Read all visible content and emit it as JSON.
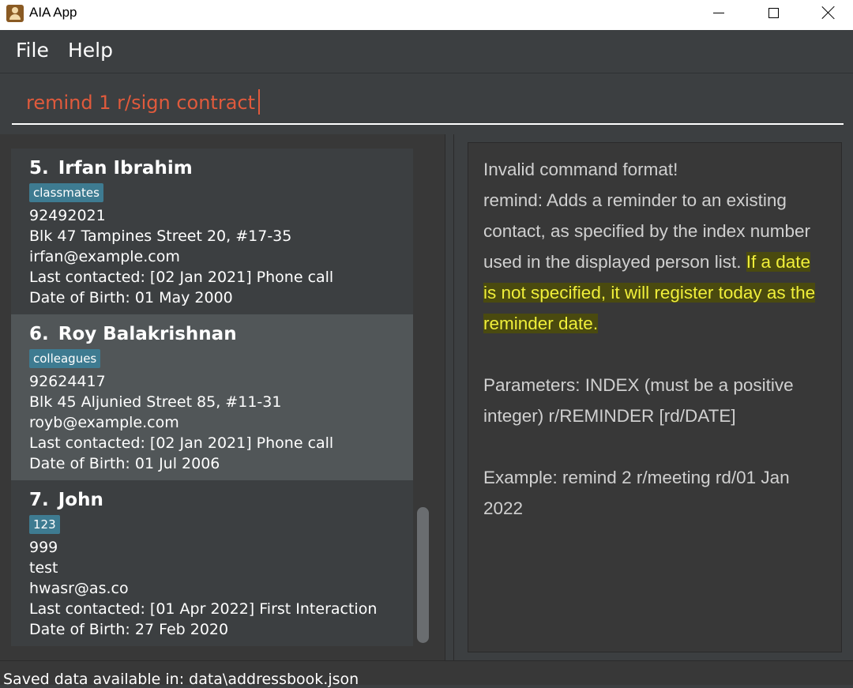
{
  "window": {
    "title": "AIA App",
    "icon": "contact-book-icon"
  },
  "menu": {
    "file": "File",
    "help": "Help"
  },
  "command": {
    "value": "remind 1 r/sign contract"
  },
  "persons": [
    {
      "index": "5.",
      "name": "Irfan Ibrahim",
      "tag": "classmates",
      "phone": "92492021",
      "address": "Blk 47 Tampines Street 20, #17-35",
      "email": "irfan@example.com",
      "last_contacted": "Last contacted: [02 Jan 2021] Phone call",
      "dob": "Date of Birth: 01 May 2000"
    },
    {
      "index": "6.",
      "name": "Roy Balakrishnan",
      "tag": "colleagues",
      "phone": "92624417",
      "address": "Blk 45 Aljunied Street 85, #11-31",
      "email": "royb@example.com",
      "last_contacted": "Last contacted: [02 Jan 2021] Phone call",
      "dob": "Date of Birth: 01 Jul 2006"
    },
    {
      "index": "7.",
      "name": "John",
      "tag": "123",
      "phone": "999",
      "address": "test",
      "email": "hwasr@as.co",
      "last_contacted": "Last contacted: [01 Apr 2022] First Interaction",
      "dob": "Date of Birth: 27 Feb 2020"
    }
  ],
  "result": {
    "line1": "Invalid command format!",
    "line2": "remind: Adds a reminder to an existing contact, as specified by the index number used in the displayed person list.",
    "highlighted": "If a date is not specified, it will register today as the reminder date.",
    "parameters": "Parameters: INDEX (must be a positive integer) r/REMINDER [rd/DATE]",
    "example": "Example: remind 2 r/meeting rd/01 Jan 2022"
  },
  "status": {
    "text": "Saved data available in: data\\addressbook.json"
  },
  "colors": {
    "background": "#3c3f41",
    "command_text": "#e05a3c",
    "tag": "#3e7b91",
    "selected_card": "#515658",
    "highlight_text": "#f0ef3a"
  }
}
